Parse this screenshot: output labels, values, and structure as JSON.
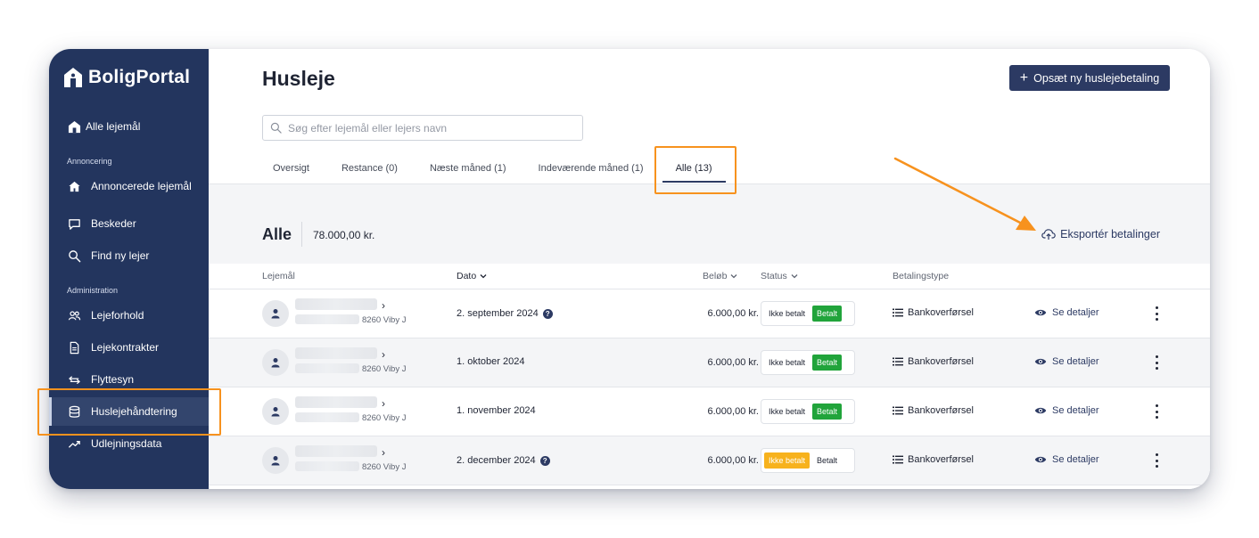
{
  "brand": {
    "name": "BoligPortal"
  },
  "sidebar": {
    "top_item": "Alle lejemål",
    "section_annoncering": "Annoncering",
    "annoncering_items": [
      "Annoncerede lejemål",
      "Beskeder",
      "Find ny lejer"
    ],
    "section_administration": "Administration",
    "administration_items": [
      "Lejeforhold",
      "Lejekontrakter",
      "Flyttesyn",
      "Huslejehåndtering",
      "Udlejningsdata"
    ],
    "active_item": "Huslejehåndtering"
  },
  "header": {
    "title": "Husleje",
    "primary_button": "Opsæt ny huslejebetaling",
    "search_placeholder": "Søg efter lejemål eller lejers navn"
  },
  "tabs": [
    "Oversigt",
    "Restance (0)",
    "Næste måned (1)",
    "Indeværende måned (1)",
    "Alle (13)"
  ],
  "active_tab": "Alle (13)",
  "summary": {
    "title": "Alle",
    "total": "78.000,00 kr.",
    "export_label": "Eksportér betalinger"
  },
  "table": {
    "columns": {
      "lejemaal": "Lejemål",
      "dato": "Dato",
      "beloeb": "Beløb",
      "status": "Status",
      "betalingstype": "Betalingstype"
    },
    "status_options": {
      "unpaid": "Ikke betalt",
      "paid": "Betalt"
    },
    "details_label": "Se detaljer",
    "rows": [
      {
        "postal": "8260 Viby J",
        "date": "2. september 2024",
        "has_info": true,
        "amount": "6.000,00 kr.",
        "status": "paid",
        "payment_type": "Bankoverførsel"
      },
      {
        "postal": "8260 Viby J",
        "date": "1. oktober 2024",
        "has_info": false,
        "amount": "6.000,00 kr.",
        "status": "paid",
        "payment_type": "Bankoverførsel"
      },
      {
        "postal": "8260 Viby J",
        "date": "1. november 2024",
        "has_info": false,
        "amount": "6.000,00 kr.",
        "status": "paid",
        "payment_type": "Bankoverførsel"
      },
      {
        "postal": "8260 Viby J",
        "date": "2. december 2024",
        "has_info": true,
        "amount": "6.000,00 kr.",
        "status": "unpaid",
        "payment_type": "Bankoverførsel"
      }
    ]
  },
  "colors": {
    "sidebar": "#23355e",
    "primary": "#2c3a63",
    "paid": "#21a43b",
    "unpaid": "#f7b21d",
    "annotation": "#f7921e"
  },
  "icons": {
    "logo": "house-logo-icon",
    "alle_lejemaal": "house-icon",
    "annoncerede": "home-icon",
    "beskeder": "chat-bubble-icon",
    "find_lejer": "search-icon",
    "lejeforhold": "users-icon",
    "lejekontrakter": "document-icon",
    "flyttesyn": "swap-arrows-icon",
    "huslejehaandtering": "database-icon",
    "udlejningsdata": "trend-icon",
    "export": "cloud-upload-icon",
    "details": "eye-icon",
    "payment_type": "list-icon",
    "more": "kebab-icon"
  }
}
